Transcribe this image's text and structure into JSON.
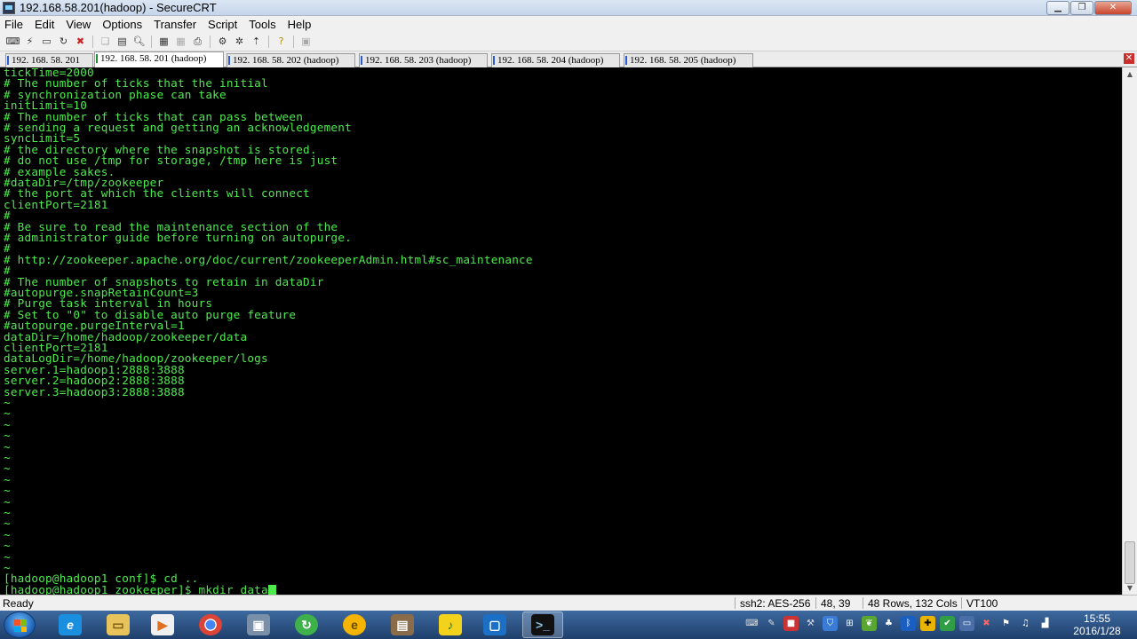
{
  "window": {
    "title": "192.168.58.201(hadoop) - SecureCRT"
  },
  "menu": [
    "File",
    "Edit",
    "View",
    "Options",
    "Transfer",
    "Script",
    "Tools",
    "Help"
  ],
  "toolbar_icons": [
    "connect-icon",
    "quick-connect-icon",
    "connect-tab-icon",
    "reconnect-icon",
    "disconnect-icon",
    "copy-icon",
    "paste-icon",
    "find-icon",
    "print-setup-icon",
    "print-icon",
    "printer-icon",
    "session-options-icon",
    "global-options-icon",
    "sftp-icon",
    "help-icon",
    "keymap-icon"
  ],
  "tabs": [
    {
      "label": "192. 168. 58. 201",
      "active": false
    },
    {
      "label": "192. 168. 58. 201 (hadoop)",
      "active": true
    },
    {
      "label": "192. 168. 58. 202 (hadoop)",
      "active": false
    },
    {
      "label": "192. 168. 58. 203 (hadoop)",
      "active": false
    },
    {
      "label": "192. 168. 58. 204 (hadoop)",
      "active": false
    },
    {
      "label": "192. 168. 58. 205 (hadoop)",
      "active": false
    }
  ],
  "terminal": {
    "lines": [
      "tickTime=2000",
      "# The number of ticks that the initial",
      "# synchronization phase can take",
      "initLimit=10",
      "# The number of ticks that can pass between",
      "# sending a request and getting an acknowledgement",
      "syncLimit=5",
      "# the directory where the snapshot is stored.",
      "# do not use /tmp for storage, /tmp here is just",
      "# example sakes.",
      "#dataDir=/tmp/zookeeper",
      "# the port at which the clients will connect",
      "clientPort=2181",
      "#",
      "# Be sure to read the maintenance section of the",
      "# administrator guide before turning on autopurge.",
      "#",
      "# http://zookeeper.apache.org/doc/current/zookeeperAdmin.html#sc_maintenance",
      "#",
      "# The number of snapshots to retain in dataDir",
      "#autopurge.snapRetainCount=3",
      "# Purge task interval in hours",
      "# Set to \"0\" to disable auto purge feature",
      "#autopurge.purgeInterval=1",
      "dataDir=/home/hadoop/zookeeper/data",
      "clientPort=2181",
      "dataLogDir=/home/hadoop/zookeeper/logs",
      "server.1=hadoop1:2888:3888",
      "server.2=hadoop2:2888:3888",
      "server.3=hadoop3:2888:3888",
      "~",
      "~",
      "~",
      "~",
      "~",
      "~",
      "~",
      "~",
      "~",
      "~",
      "~",
      "~",
      "~",
      "~",
      "~",
      "~",
      "[hadoop@hadoop1 conf]$ cd ..",
      "[hadoop@hadoop1 zookeeper]$ mkdir data"
    ]
  },
  "status": {
    "state": "Ready",
    "protocol": "ssh2: AES-256",
    "cursor_pos": "48,  39",
    "size": "48 Rows, 132 Cols",
    "emulation": "VT100"
  },
  "taskbar": {
    "apps": [
      "internet-explorer-icon",
      "file-explorer-icon",
      "media-player-icon",
      "chrome-icon",
      "network-tool-icon",
      "refresh-app-icon",
      "mail-app-icon",
      "archive-app-icon",
      "music-app-icon",
      "virtualbox-icon",
      "securecrt-icon"
    ],
    "time": "15:55",
    "date": "2016/1/28"
  }
}
